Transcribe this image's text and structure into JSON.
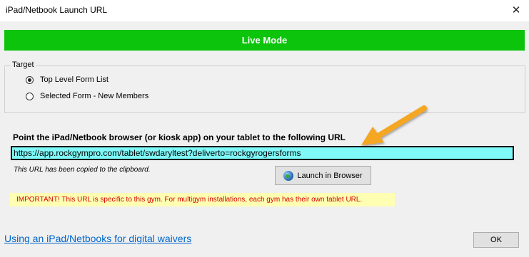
{
  "window": {
    "title": "iPad/Netbook Launch URL",
    "close_glyph": "✕"
  },
  "banner": {
    "label": "Live Mode",
    "color": "#0bc40b"
  },
  "target": {
    "legend": "Target",
    "options": [
      {
        "label": "Top Level Form List",
        "checked": true
      },
      {
        "label": "Selected Form - New Members",
        "checked": false
      }
    ]
  },
  "instructions": {
    "prompt": "Point the iPad/Netbook browser (or kiosk app) on your tablet to the following URL",
    "url": "https://app.rockgympro.com/tablet/swdaryltest?deliverto=rockgyrogersforms",
    "copied_note": "This URL has been copied to the clipboard."
  },
  "launch_button": {
    "label": "Launch in Browser",
    "icon": "globe-icon"
  },
  "important": {
    "text": "IMPORTANT!  This URL is specific to this gym.  For multigym installations, each gym has their own tablet URL.",
    "color": "#d40000"
  },
  "footer": {
    "help_link": "Using an iPad/Netbooks for digital waivers",
    "ok_label": "OK"
  },
  "annotation": {
    "arrow_color": "#f5a623"
  }
}
